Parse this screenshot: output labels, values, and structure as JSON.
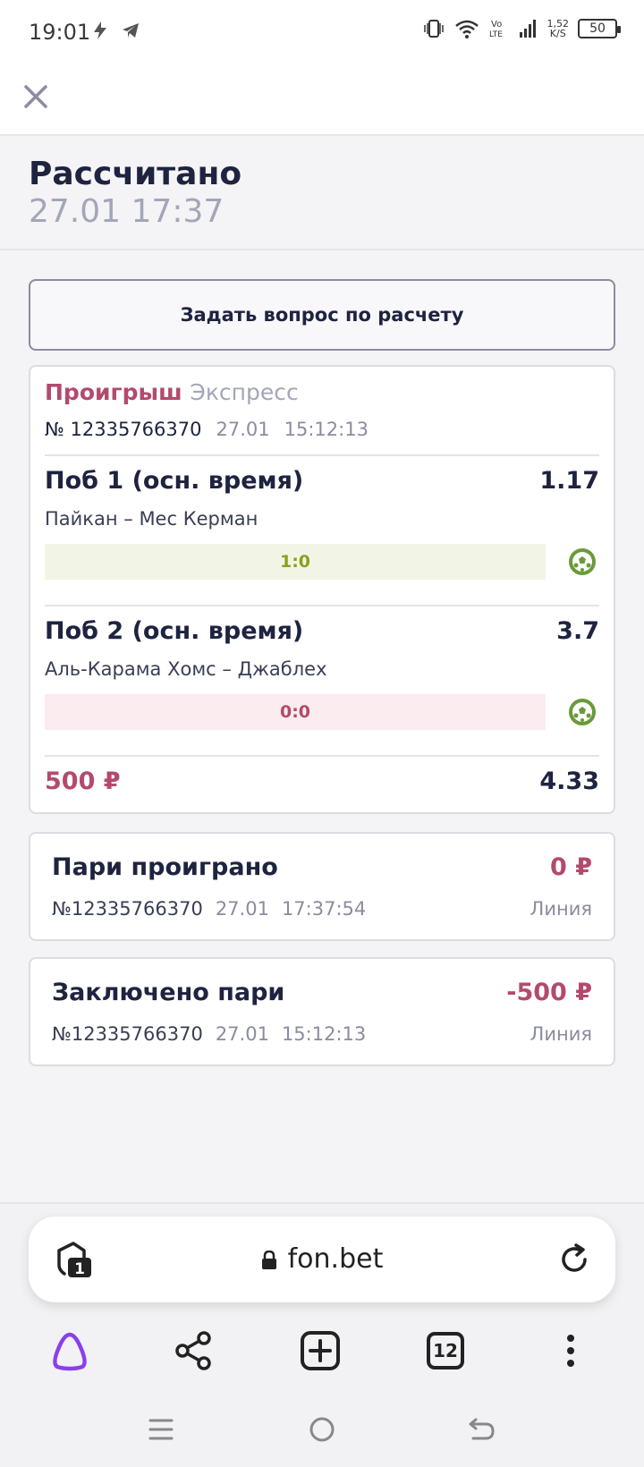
{
  "status_bar": {
    "time": "19:01",
    "net_speed_top": "1,52",
    "net_speed_bottom": "K/S",
    "battery": "50"
  },
  "header": {
    "status_title": "Рассчитано",
    "status_date": "27.01 17:37"
  },
  "ask_button": "Задать вопрос по расчету",
  "bet": {
    "result": "Проигрыш",
    "kind": "Экспресс",
    "number": "№ 12335766370",
    "date": "27.01",
    "time": "15:12:13",
    "events": [
      {
        "title": "Поб 1 (осн. время)",
        "odds": "1.17",
        "teams": "Пайкан – Мес Керман",
        "score": "1:0"
      },
      {
        "title": "Поб 2 (осн. время)",
        "odds": "3.7",
        "teams": "Аль-Карама Хомс – Джаблех",
        "score": "0:0"
      }
    ],
    "stake": "500 ₽",
    "total_odds": "4.33"
  },
  "transactions": [
    {
      "title": "Пари проиграно",
      "amount": "0 ₽",
      "number": "№12335766370",
      "date": "27.01",
      "time": "17:37:54",
      "source": "Линия"
    },
    {
      "title": "Заключено пари",
      "amount": "-500 ₽",
      "number": "№12335766370",
      "date": "27.01",
      "time": "15:12:13",
      "source": "Линия"
    }
  ],
  "browser": {
    "url": "fon.bet",
    "protect_badge": "1",
    "tabs_count": "12"
  },
  "colors": {
    "accent_loss": "#b34a6e",
    "win_score": "#8aa020",
    "primary_text": "#1e2340",
    "muted_text": "#a3a6b8",
    "alice_purple": "#8a3ff0"
  }
}
